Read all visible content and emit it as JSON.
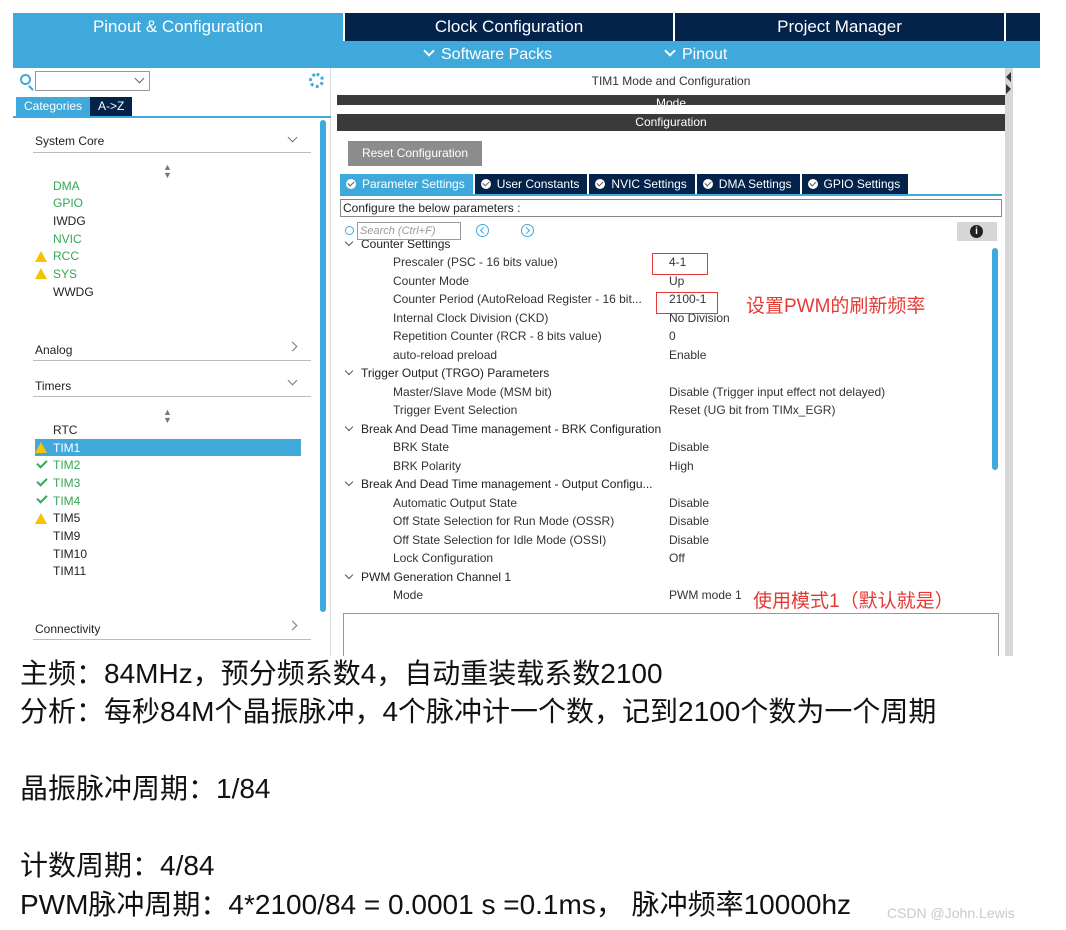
{
  "topbar": {
    "tabs": [
      "Pinout & Configuration",
      "Clock Configuration",
      "Project Manager"
    ],
    "menus": [
      "Software Packs",
      "Pinout"
    ]
  },
  "left": {
    "search_value": "",
    "tab_categories": "Categories",
    "tab_az": "A->Z",
    "sections": {
      "system_core": "System Core",
      "analog": "Analog",
      "timers": "Timers",
      "connectivity": "Connectivity"
    },
    "system_core_items": [
      "DMA",
      "GPIO",
      "IWDG",
      "NVIC",
      "RCC",
      "SYS",
      "WWDG"
    ],
    "timers_items": [
      "RTC",
      "TIM1",
      "TIM2",
      "TIM3",
      "TIM4",
      "TIM5",
      "TIM9",
      "TIM10",
      "TIM11"
    ]
  },
  "right": {
    "title": "TIM1 Mode and Configuration",
    "mode_band": "Mode",
    "config_band": "Configuration",
    "reset_button": "Reset Configuration",
    "tabs": [
      "Parameter Settings",
      "User Constants",
      "NVIC Settings",
      "DMA Settings",
      "GPIO Settings"
    ],
    "configure_text": "Configure the below parameters :",
    "search_placeholder": "Search (Ctrl+F)",
    "info_icon": "i",
    "groups": {
      "counter": "Counter Settings",
      "trgo": "Trigger Output (TRGO) Parameters",
      "brk": "Break And Dead Time management - BRK Configuration",
      "output": "Break And Dead Time management - Output Configu...",
      "pwm": "PWM Generation Channel 1"
    },
    "params": {
      "prescaler": {
        "name": "Prescaler (PSC - 16 bits value)",
        "value": "4-1"
      },
      "counter_mode": {
        "name": "Counter Mode",
        "value": "Up"
      },
      "counter_period": {
        "name": "Counter Period (AutoReload Register - 16 bit...",
        "value": "2100-1"
      },
      "ckd": {
        "name": "Internal Clock Division (CKD)",
        "value": "No Division"
      },
      "rcr": {
        "name": "Repetition Counter (RCR - 8 bits value)",
        "value": "0"
      },
      "arpe": {
        "name": "auto-reload preload",
        "value": "Enable"
      },
      "msm": {
        "name": "Master/Slave Mode (MSM bit)",
        "value": "Disable (Trigger input effect not delayed)"
      },
      "trgo_sel": {
        "name": "Trigger Event Selection",
        "value": "Reset (UG bit from TIMx_EGR)"
      },
      "brk_state": {
        "name": "BRK State",
        "value": "Disable"
      },
      "brk_pol": {
        "name": "BRK Polarity",
        "value": "High"
      },
      "aoe": {
        "name": "Automatic Output State",
        "value": "Disable"
      },
      "ossr": {
        "name": "Off State Selection for Run Mode (OSSR)",
        "value": "Disable"
      },
      "ossi": {
        "name": "Off State Selection for Idle Mode (OSSI)",
        "value": "Disable"
      },
      "lock": {
        "name": "Lock Configuration",
        "value": "Off"
      },
      "mode": {
        "name": "Mode",
        "value": "PWM mode 1"
      }
    }
  },
  "annotations": {
    "period_note": "设置PWM的刷新频率",
    "mode_note": "使用模式1（默认就是）"
  },
  "caption": {
    "line1": "主频：84MHz，预分频系数4，自动重装载系数2100",
    "line2": "分析：每秒84M个晶振脉冲，4个脉冲计一个数，记到2100个数为一个周期",
    "line3": "晶振脉冲周期：1/84",
    "line4": "计数周期：4/84",
    "line5": "PWM脉冲周期：4*2100/84 = 0.0001 s =0.1ms， 脉冲频率10000hz"
  },
  "watermark": "CSDN @John.Lewis",
  "colors": {
    "navy": "#03234b",
    "accent": "#3fa9dc",
    "green": "#34a853",
    "warning": "#f5c400",
    "annotation_red": "#e53935"
  }
}
